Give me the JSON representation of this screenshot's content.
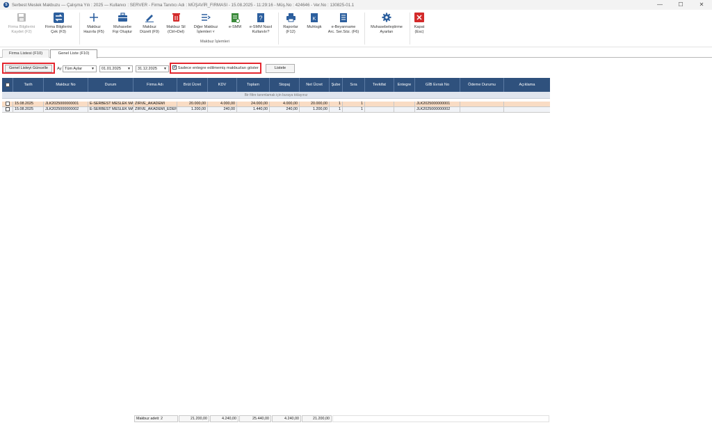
{
  "window": {
    "title": "Serbest Meslek Makbuzu  —  Çalışma Yılı : 2025  —  Kullanıcı : SERVER  - Firma Tanıtıcı Adı : MÜŞAVİR_FIRMASI - 15.08.2025 - 11:29:16 - Müş.No : 424646 - Ver.No : 130825-01.1",
    "minimize": "—",
    "maximize": "☐",
    "close": "✕"
  },
  "ribbon": {
    "group_label": "Makbuz İşlemleri",
    "buttons": [
      {
        "line1": "Firma Bilgilerini",
        "line2": "Kaydet (F2)",
        "icon": "save-icon"
      },
      {
        "line1": "Firma Bilgilerini",
        "line2": "Çek (F3)",
        "icon": "refresh-icon"
      },
      {
        "line1": "Makbuz",
        "line2": "Hazırla (F5)",
        "icon": "plus-icon"
      },
      {
        "line1": "Muhasebe",
        "line2": "Fişi Oluştur",
        "icon": "briefcase-icon"
      },
      {
        "line1": "Makbuz",
        "line2": "Düzelt (F9)",
        "icon": "pencil-icon"
      },
      {
        "line1": "Makbuz Sil",
        "line2": "(Ctrl+Del)",
        "icon": "trash-icon"
      },
      {
        "line1": "Diğer Makbuz",
        "line2": "İşlemleri ˅",
        "icon": "list-icon"
      },
      {
        "line1": "e-SMM",
        "line2": "",
        "icon": "esmm-doc-icon"
      },
      {
        "line1": "e-SMM Nasıl",
        "line2": "Kullanılır?",
        "icon": "help-doc-icon"
      },
      {
        "line1": "Raporlar",
        "line2": "(F12)",
        "icon": "printer-icon"
      },
      {
        "line1": "Muhtsgk",
        "line2": "",
        "icon": "muhtsgk-doc-icon"
      },
      {
        "line1": "e-Beyanname",
        "line2": "Arc. Ser.Söz. (F6)",
        "icon": "document-icon"
      },
      {
        "line1": "Muhasebeleştirme",
        "line2": "Ayarları",
        "icon": "gear-icon"
      },
      {
        "line1": "Kapat",
        "line2": "(Esc)",
        "icon": "close-icon"
      }
    ]
  },
  "tabs": [
    "Firma Listesi (F10)",
    "Genel Liste (F10)"
  ],
  "filters": {
    "refresh_button": "Genel Listeyi Güncelle",
    "period_label": "Ay",
    "period_value": "Tüm Aylar",
    "start_date": "01.01.2025",
    "end_date": "31.12.2025",
    "checkbox_label": "Sadece entegre edilmemiş makbuzları göster",
    "list_button": "Listele"
  },
  "grid": {
    "group_hint": "Bir filtre tanımlamak için buraya tıklayınız",
    "columns": [
      "",
      "Tarih",
      "Makbuz No",
      "Durum",
      "Firma Adı",
      "Brüt Ücret",
      "KDV",
      "Toplam",
      "Stopaj",
      "Net Ücret",
      "Şube",
      "Sıra",
      "Tevkifat",
      "Entegre",
      "GİB Evrak No",
      "Ödeme Durumu",
      "Açıklama"
    ],
    "rows": [
      [
        "15.08.2025",
        "JLK2025000000001",
        "E-SERBEST MESLEK MAKBUZU",
        "ZİRVE_AKADEMİ",
        "20.000,00",
        "4.000,00",
        "24.000,00",
        "4.000,00",
        "20.000,00",
        "1",
        "1",
        "",
        "",
        "JLK2025000000001",
        "",
        ""
      ],
      [
        "15.08.2025",
        "JLK2025000000002",
        "E-SERBEST MESLEK MAKBUZU",
        "ZİRVE_AKADEMİ_EDEFTER",
        "1.200,00",
        "240,00",
        "1.440,00",
        "240,00",
        "1.200,00",
        "1",
        "1",
        "",
        "",
        "JLK2025000000002",
        "",
        ""
      ]
    ]
  },
  "footer": {
    "count": "Makbuz adeti: 2",
    "brut": "21.200,00",
    "kdv": "4.240,00",
    "toplam": "25.440,00",
    "stopaj": "4.240,00",
    "net": "21.200,00"
  }
}
